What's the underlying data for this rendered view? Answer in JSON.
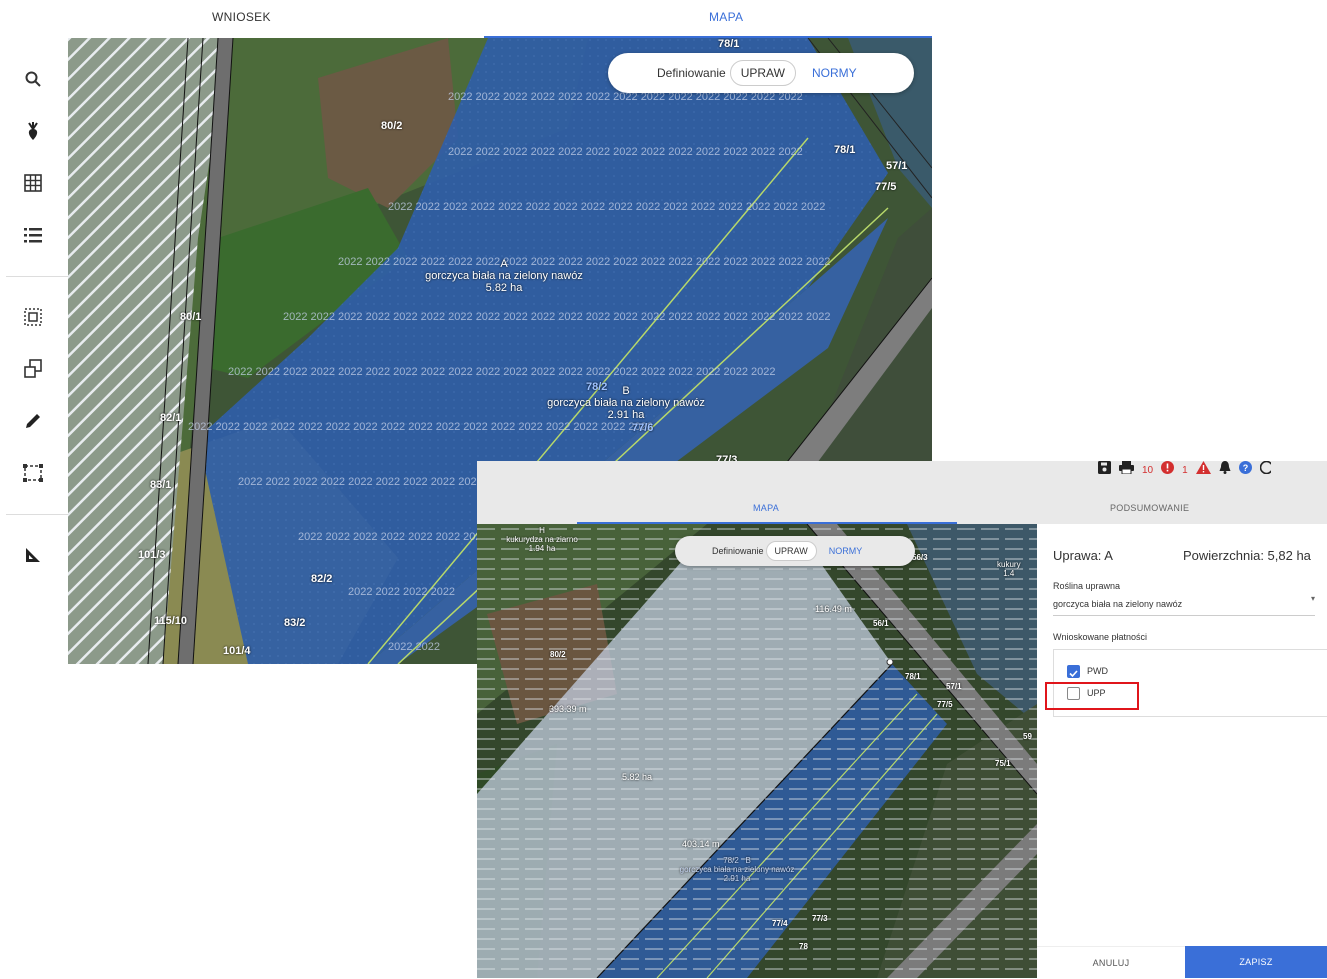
{
  "screen1": {
    "tabs": [
      {
        "label": "WNIOSEK",
        "active": false
      },
      {
        "label": "MAPA",
        "active": true
      }
    ],
    "sidebar": {
      "tools": [
        "search-icon",
        "crop-plant-icon",
        "grid-table-icon",
        "list-icon",
        "select-area-icon",
        "copy-geometry-icon",
        "edit-pencil-icon",
        "bounding-box-icon",
        "measure-ruler-icon"
      ]
    },
    "mode_switch": {
      "prefix": "Definiowanie",
      "selected": "UPRAW",
      "option": "NORMY"
    },
    "map": {
      "watermark": "2022",
      "parcel_labels": [
        "80/2",
        "80/1",
        "82/1",
        "83/1",
        "101/3",
        "82/2",
        "83/2",
        "115/10",
        "101/4",
        "78/1",
        "57/1",
        "77/5",
        "77/3",
        "78/2",
        "77/6",
        "78/1"
      ],
      "crops": [
        {
          "letter": "A",
          "name": "gorczyca biała na zielony nawóz",
          "area": "5.82 ha"
        },
        {
          "letter": "B",
          "name": "gorczyca biała na zielony nawóz",
          "area": "2.91 ha"
        }
      ]
    }
  },
  "screen2": {
    "toolbar": {
      "warnings_count": "10",
      "errors_count": "1"
    },
    "tabs": [
      {
        "label": "MAPA",
        "active": true
      },
      {
        "label": "PODSUMOWANIE",
        "active": false
      }
    ],
    "mode_switch": {
      "prefix": "Definiowanie",
      "selected": "UPRAW",
      "option": "NORMY"
    },
    "map": {
      "other_crop": {
        "letter": "H",
        "name": "kukurydza na ziarno",
        "area": "1.94 ha"
      },
      "cut_label": "kukury",
      "cut_area": "1.4",
      "measurements": [
        "116.49 m",
        "393.39 m",
        "403.14 m"
      ],
      "area_mark": "5.82 ha",
      "parcel_labels": [
        "80/2",
        "78/1",
        "56/1",
        "57/1",
        "77/5",
        "75/1",
        "59",
        "77/4",
        "77/3",
        "78",
        "56/3"
      ],
      "crop_b": {
        "code": "78/2",
        "letter": "B",
        "name": "gorczyca biała na zielony nawóz",
        "area": "2.91 ha"
      }
    },
    "panel": {
      "title_prefix": "Uprawa: A",
      "area_label": "Powierzchnia: 5,82 ha",
      "plant_label": "Roślina uprawna",
      "plant_value": "gorczyca biała na zielony nawóz",
      "payments_label": "Wnioskowane płatności",
      "payments": [
        {
          "label": "PWD",
          "checked": true
        },
        {
          "label": "UPP",
          "checked": false
        }
      ],
      "cancel": "ANULUJ",
      "save": "ZAPISZ"
    },
    "colors": {
      "accent": "#3a6fd8",
      "highlight": "#e0151b",
      "error": "#d32f2f"
    }
  }
}
